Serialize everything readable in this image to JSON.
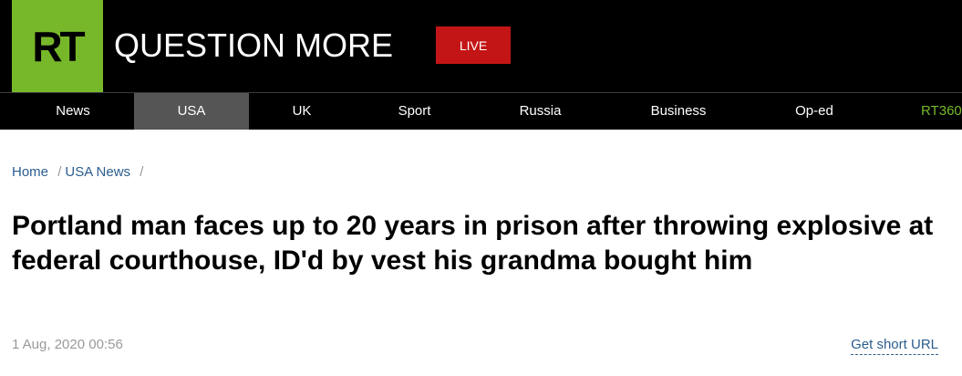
{
  "header": {
    "logo": "RT",
    "slogan": "QUESTION MORE",
    "live_label": "LIVE"
  },
  "nav": {
    "items": [
      {
        "label": "News"
      },
      {
        "label": "USA",
        "active": true
      },
      {
        "label": "UK"
      },
      {
        "label": "Sport"
      },
      {
        "label": "Russia"
      },
      {
        "label": "Business"
      },
      {
        "label": "Op-ed"
      },
      {
        "label": "RT360"
      }
    ]
  },
  "breadcrumb": {
    "items": [
      "Home",
      "USA News"
    ],
    "separator": "/"
  },
  "article": {
    "title": "Portland man faces up to 20 years in prison after throwing explosive at federal courthouse, ID'd by vest his grandma bought him",
    "date": "1 Aug, 2020 00:56",
    "short_url_label": "Get short URL"
  },
  "colors": {
    "brand_green": "#77b82a",
    "live_red": "#c31515",
    "link_blue": "#2b5d8e",
    "active_tab": "#555555"
  }
}
